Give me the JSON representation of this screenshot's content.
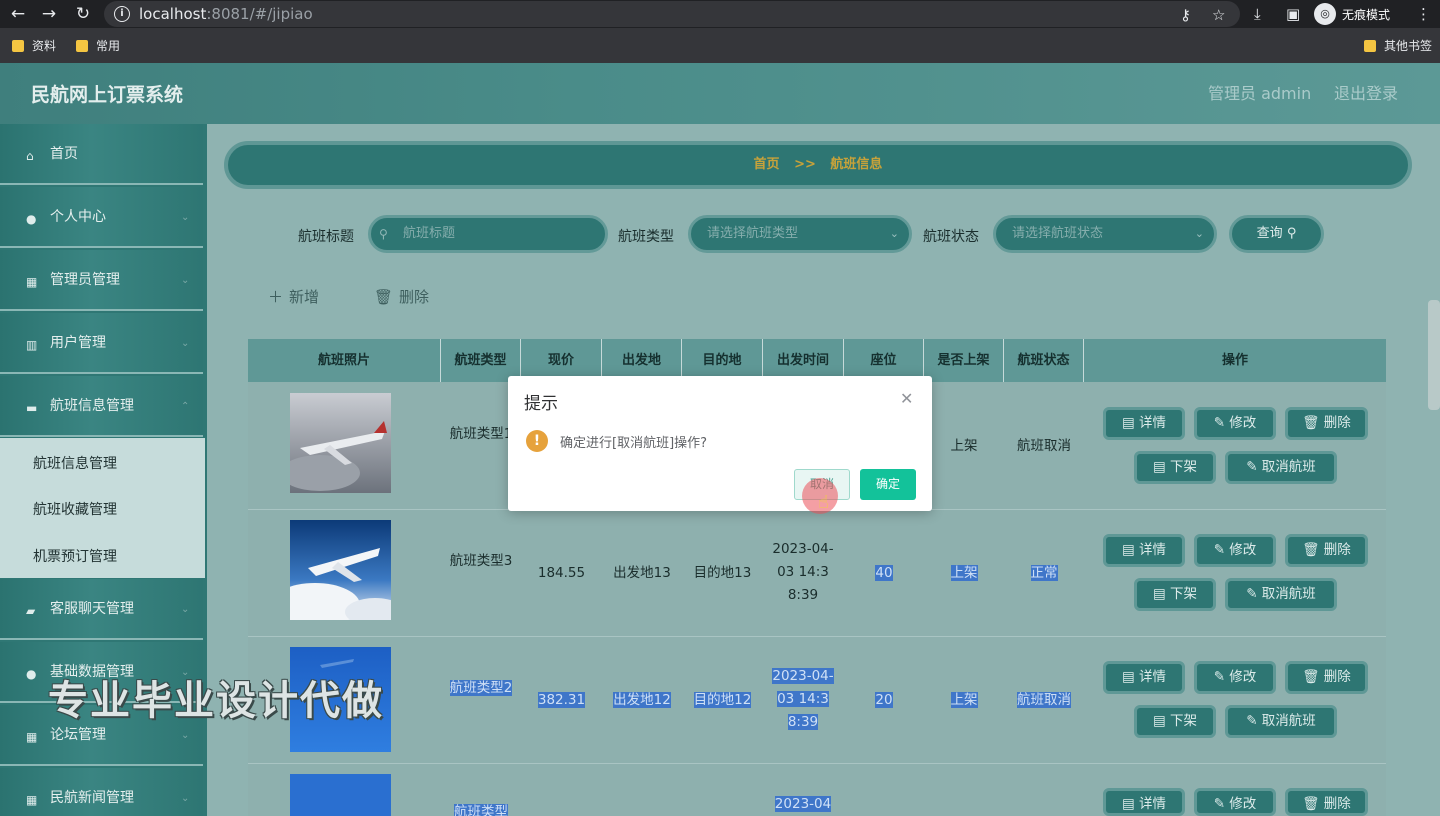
{
  "browser": {
    "url_host": "localhost",
    "url_rest": ":8081/#/jipiao",
    "incognito_label": "无痕模式",
    "bookmarks": [
      "资料",
      "常用"
    ],
    "other_bookmarks": "其他书签"
  },
  "app": {
    "title": "民航网上订票系统",
    "user": "管理员 admin",
    "logout": "退出登录"
  },
  "sidebar": {
    "items": [
      {
        "label": "首页",
        "icon": "home-icon"
      },
      {
        "label": "个人中心",
        "icon": "user-icon"
      },
      {
        "label": "管理员管理",
        "icon": "grid-icon"
      },
      {
        "label": "用户管理",
        "icon": "chart-icon"
      },
      {
        "label": "航班信息管理",
        "icon": "monitor-icon"
      },
      {
        "label": "客服聊天管理",
        "icon": "chat-icon"
      },
      {
        "label": "基础数据管理",
        "icon": "user-icon"
      },
      {
        "label": "论坛管理",
        "icon": "grid-icon"
      },
      {
        "label": "民航新闻管理",
        "icon": "grid-icon"
      }
    ],
    "submenu": [
      "航班信息管理",
      "航班收藏管理",
      "机票预订管理"
    ]
  },
  "breadcrumb": {
    "home": "首页",
    "sep": ">>",
    "current": "航班信息"
  },
  "filters": {
    "title_label": "航班标题",
    "title_placeholder": "航班标题",
    "type_label": "航班类型",
    "type_placeholder": "请选择航班类型",
    "status_label": "航班状态",
    "status_placeholder": "请选择航班状态",
    "query": "查询"
  },
  "actions": {
    "add": "新增",
    "delete": "删除"
  },
  "table": {
    "headers": [
      "航班照片",
      "航班类型",
      "现价",
      "出发地",
      "目的地",
      "出发时间",
      "座位",
      "是否上架",
      "航班状态",
      "操作"
    ],
    "rows": [
      {
        "type": "航班类型1",
        "price": "",
        "from": "",
        "to": "",
        "time": "",
        "seats": "",
        "listed": "上架",
        "status": "航班取消"
      },
      {
        "type": "航班类型3",
        "price": "184.55",
        "from": "出发地13",
        "to": "目的地13",
        "time": "2023-04-03 14:38:39",
        "seats": "40",
        "listed": "上架",
        "status": "正常"
      },
      {
        "type": "航班类型2",
        "price": "382.31",
        "from": "出发地12",
        "to": "目的地12",
        "time": "2023-04-03 14:38:39",
        "seats": "20",
        "listed": "上架",
        "status": "航班取消"
      },
      {
        "type": "航班类型",
        "time": "2023-04"
      }
    ],
    "ops": {
      "detail": "详情",
      "edit": "修改",
      "delete": "删除",
      "unlist": "下架",
      "cancel": "取消航班"
    }
  },
  "dialog": {
    "title": "提示",
    "message": "确定进行[取消航班]操作?",
    "cancel": "取消",
    "confirm": "确定"
  },
  "watermark": "专业毕业设计代做",
  "colors": {
    "accent": "#2e7673",
    "confirm": "#13c29a",
    "warning": "#e6a23c",
    "breadcrumb_text": "#c7a23a"
  }
}
